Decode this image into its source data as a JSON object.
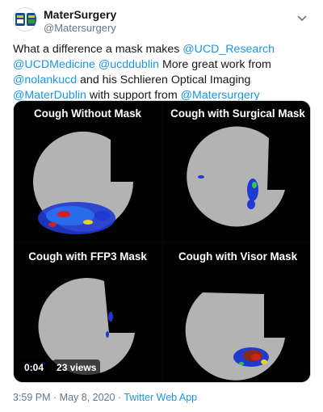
{
  "user": {
    "display_name": "MaterSurgery",
    "handle": "@Matersurgery"
  },
  "tweet": {
    "segments": [
      {
        "text": "What a difference a mask makes ",
        "link": false
      },
      {
        "text": "@UCD_Research",
        "link": true
      },
      {
        "text": " ",
        "link": false
      },
      {
        "text": "@UCDMedicine",
        "link": true
      },
      {
        "text": " ",
        "link": false
      },
      {
        "text": "@ucddublin",
        "link": true
      },
      {
        "text": " More great work from ",
        "link": false
      },
      {
        "text": "@nolankucd",
        "link": true
      },
      {
        "text": " and his Schlieren Optical Imaging ",
        "link": false
      },
      {
        "text": "@MaterDublin",
        "link": true
      },
      {
        "text": " with support from ",
        "link": false
      },
      {
        "text": "@Matersurgery",
        "link": true
      }
    ]
  },
  "media": {
    "panels": [
      {
        "title": "Cough Without Mask"
      },
      {
        "title": "Cough with Surgical Mask"
      },
      {
        "title": "Cough with FFP3 Mask"
      },
      {
        "title": "Cough with Visor Mask"
      }
    ],
    "video_time": "0:04",
    "views": "23 views"
  },
  "footer": {
    "timestamp": "3:59 PM · May 8, 2020 · ",
    "source": "Twitter Web App"
  },
  "colors": {
    "link": "#1b95e0",
    "secondary_text": "#657786",
    "panel_background": "#020202",
    "schlieren_field": "#b3b3b3"
  },
  "icons": {
    "avatar": "ucd-mater-crest-icon",
    "menu": "chevron-down-icon"
  }
}
